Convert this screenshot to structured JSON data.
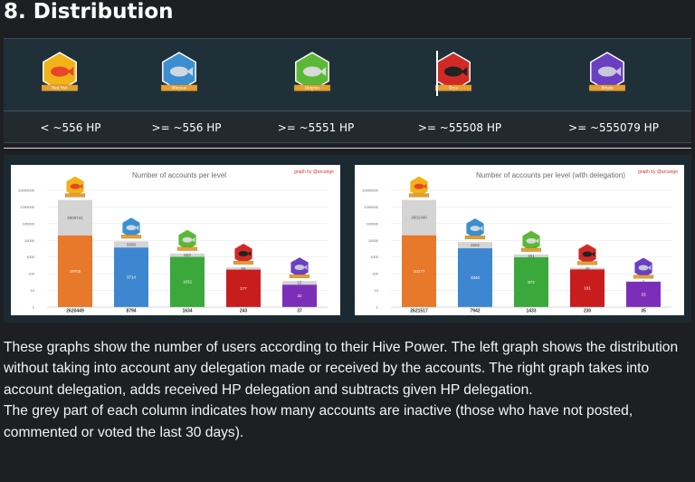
{
  "heading": "8. Distribution",
  "levels": [
    {
      "name": "Red Fish",
      "threshold": "< ~556 HP",
      "color": "#f2b318",
      "creature": "#e8452c"
    },
    {
      "name": "Minnow",
      "threshold": ">= ~556 HP",
      "color": "#3b8fd0",
      "creature": "#cfd8e0"
    },
    {
      "name": "Dolphin",
      "threshold": ">= ~5551 HP",
      "color": "#5bb836",
      "creature": "#d9d9d9"
    },
    {
      "name": "Orca",
      "threshold": ">= ~55508 HP",
      "color": "#d12a26",
      "creature": "#222222"
    },
    {
      "name": "Whale",
      "threshold": ">= ~555079 HP",
      "color": "#6b3fc2",
      "creature": "#c8c8d8"
    }
  ],
  "chart_data": [
    {
      "type": "bar",
      "title": "Number of accounts per level",
      "credit": "graph by @arcange",
      "yscale": "log",
      "ylim": [
        1,
        10000000
      ],
      "yticks": [
        "10000000",
        "1000000",
        "100000",
        "10000",
        "1000",
        "100",
        "10",
        "1"
      ],
      "categories": [
        "Red Fish",
        "Minnow",
        "Dolphin",
        "Orca",
        "Whale"
      ],
      "colors": [
        "#e8782a",
        "#3f86d1",
        "#3aa83a",
        "#c81d1d",
        "#7b2fb8"
      ],
      "totals": [
        2620449,
        8794,
        1634,
        243,
        37
      ],
      "active": [
        19708,
        3714,
        1032,
        177,
        22
      ],
      "inactive": [
        2600741,
        5080,
        602,
        66,
        15
      ],
      "total_labels": [
        "2620449",
        "8794",
        "1634",
        "243",
        "37"
      ],
      "active_labels": [
        "19708",
        "3714",
        "1032",
        "177",
        "22"
      ],
      "inactive_labels": [
        "2600741",
        "5080",
        "602",
        "66",
        "15"
      ]
    },
    {
      "type": "bar",
      "title": "Number of accounts per level (with delegation)",
      "credit": "graph by @arcange",
      "yscale": "log",
      "ylim": [
        1,
        10000000
      ],
      "yticks": [
        "10000000",
        "1000000",
        "100000",
        "10000",
        "1000",
        "100",
        "10",
        "1"
      ],
      "categories": [
        "Red Fish",
        "Minnow",
        "Dolphin",
        "Orca",
        "Whale"
      ],
      "colors": [
        "#e8782a",
        "#3f86d1",
        "#3aa83a",
        "#c81d1d",
        "#7b2fb8"
      ],
      "totals": [
        2621517,
        7942,
        1433,
        230,
        35
      ],
      "active": [
        20177,
        3340,
        972,
        181,
        33
      ],
      "inactive": [
        2601340,
        4602,
        461,
        49,
        2
      ],
      "total_labels": [
        "2621517",
        "7942",
        "1433",
        "230",
        "35"
      ],
      "active_labels": [
        "20177",
        "3340",
        "972",
        "181",
        "33"
      ],
      "inactive_labels": [
        "2601340",
        "4602",
        "461",
        "49",
        "2"
      ]
    }
  ],
  "paragraph_1": "These graphs show the number of users according to their Hive Power. The left graph shows the distribution without taking into account any delegation made or received by the accounts. The right graph takes into account delegation, adds received HP delegation and subtracts given HP delegation.",
  "paragraph_2": "The grey part of each column indicates how many accounts are inactive (those who have not posted, commented or voted the last 30 days)."
}
